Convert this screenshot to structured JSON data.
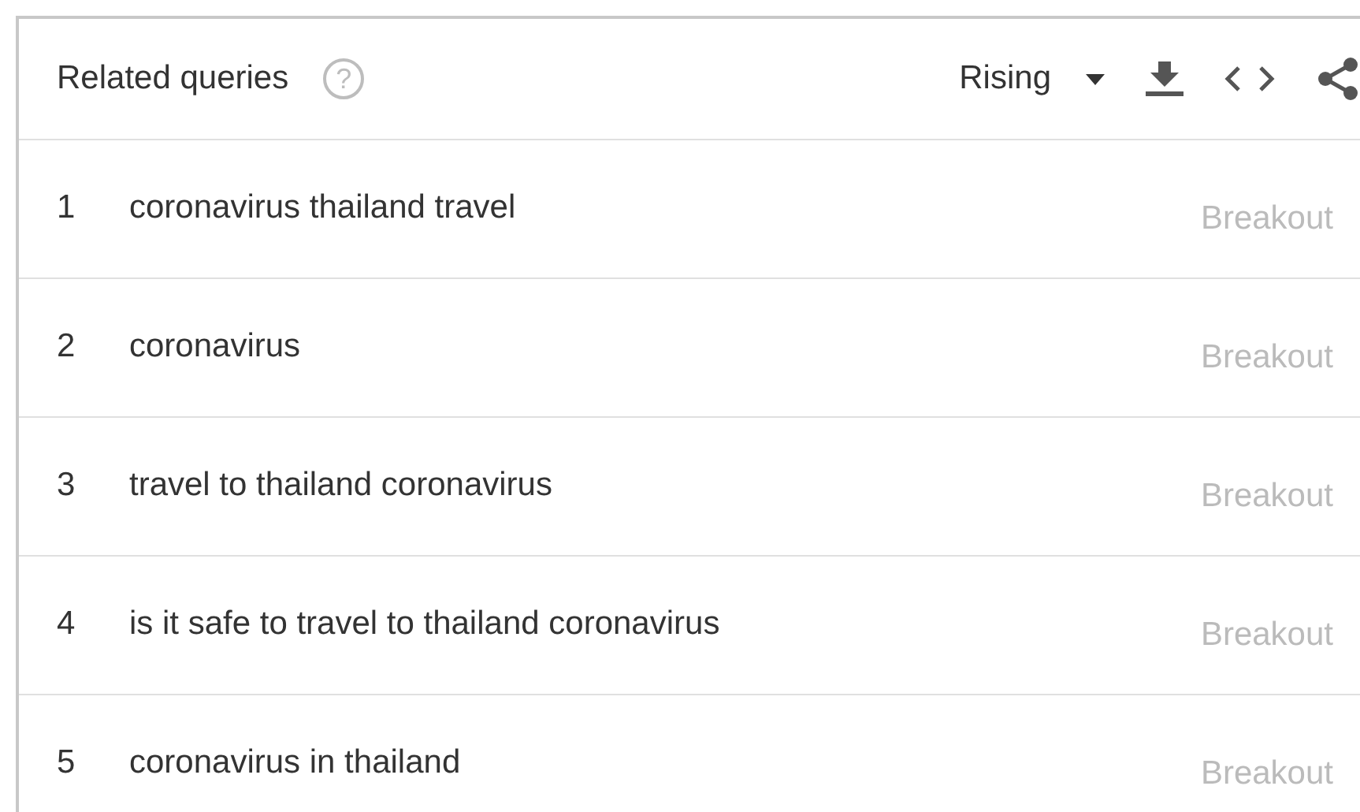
{
  "header": {
    "title": "Related queries",
    "help": "?",
    "filter": "Rising"
  },
  "rows": [
    {
      "rank": "1",
      "query": "coronavirus thailand travel",
      "value": "Breakout"
    },
    {
      "rank": "2",
      "query": "coronavirus",
      "value": "Breakout"
    },
    {
      "rank": "3",
      "query": "travel to thailand coronavirus",
      "value": "Breakout"
    },
    {
      "rank": "4",
      "query": "is it safe to travel to thailand coronavirus",
      "value": "Breakout"
    },
    {
      "rank": "5",
      "query": "coronavirus in thailand",
      "value": "Breakout"
    }
  ]
}
